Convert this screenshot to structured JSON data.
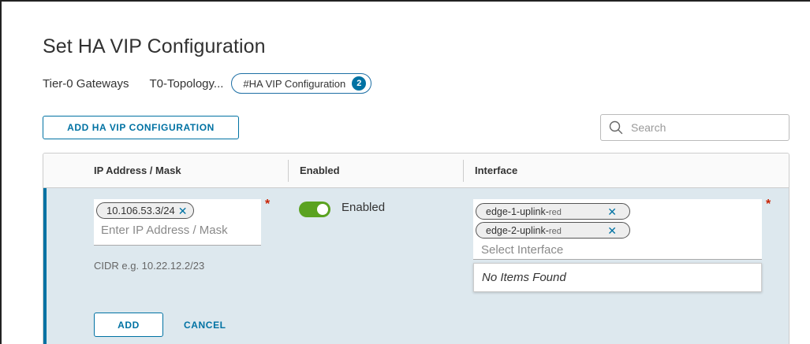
{
  "page": {
    "title": "Set HA VIP Configuration"
  },
  "breadcrumb": {
    "items": [
      "Tier-0 Gateways",
      "T0-Topology..."
    ],
    "active_tab": "#HA VIP Configuration",
    "active_count": "2"
  },
  "toolbar": {
    "add_label": "ADD HA VIP CONFIGURATION",
    "search_placeholder": "Search"
  },
  "grid": {
    "columns": [
      "IP Address / Mask",
      "Enabled",
      "Interface"
    ],
    "edit_row": {
      "ip_chips": [
        "10.106.53.3/24"
      ],
      "ip_placeholder": "Enter IP Address / Mask",
      "ip_help": "CIDR e.g. 10.22.12.2/23",
      "enabled": true,
      "enabled_label": "Enabled",
      "interface_chips": [
        {
          "name": "edge-1-uplink",
          "suffix": "red"
        },
        {
          "name": "edge-2-uplink",
          "suffix": "red"
        }
      ],
      "interface_placeholder": "Select Interface",
      "dropdown_empty": "No Items Found",
      "required_marker": "*",
      "chip_remove": "✕",
      "add_label": "ADD",
      "cancel_label": "CANCEL"
    }
  },
  "colors": {
    "accent": "#0072a3",
    "toggle_on": "#5aa220",
    "required": "#c92100",
    "edit_row_bg": "#dde8ee"
  },
  "icons": [
    "search-icon",
    "close-icon"
  ]
}
